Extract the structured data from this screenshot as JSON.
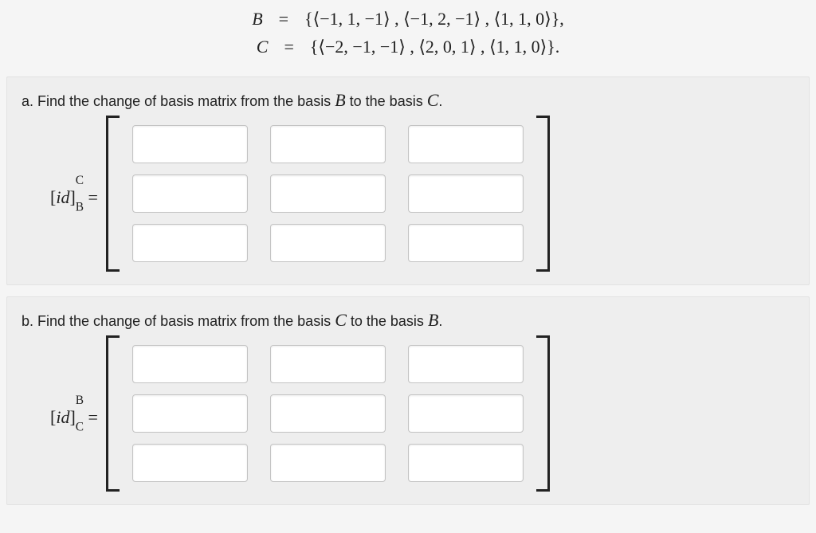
{
  "basis_definitions": {
    "B": {
      "letter": "B",
      "eq": "=",
      "rhs": "{⟨−1, 1, −1⟩ , ⟨−1, 2, −1⟩ , ⟨1, 1, 0⟩},"
    },
    "C": {
      "letter": "C",
      "eq": "=",
      "rhs": "{⟨−2, −1, −1⟩ , ⟨2, 0, 1⟩ , ⟨1, 1, 0⟩}."
    }
  },
  "parts": {
    "a": {
      "prompt": "a. Find the change of basis matrix from the basis ",
      "mid": " to the basis ",
      "end": ".",
      "from": "B",
      "to": "C",
      "label_html": "[<i>id</i>]",
      "sup": "C",
      "sub": "B",
      "eq": " ="
    },
    "b": {
      "prompt": "b. Find the change of basis matrix from the basis ",
      "mid": " to the basis ",
      "end": ".",
      "from": "C",
      "to": "B",
      "label_html": "[<i>id</i>]",
      "sup": "B",
      "sub": "C",
      "eq": " ="
    }
  },
  "matrix": {
    "rows": 3,
    "cols": 3
  }
}
